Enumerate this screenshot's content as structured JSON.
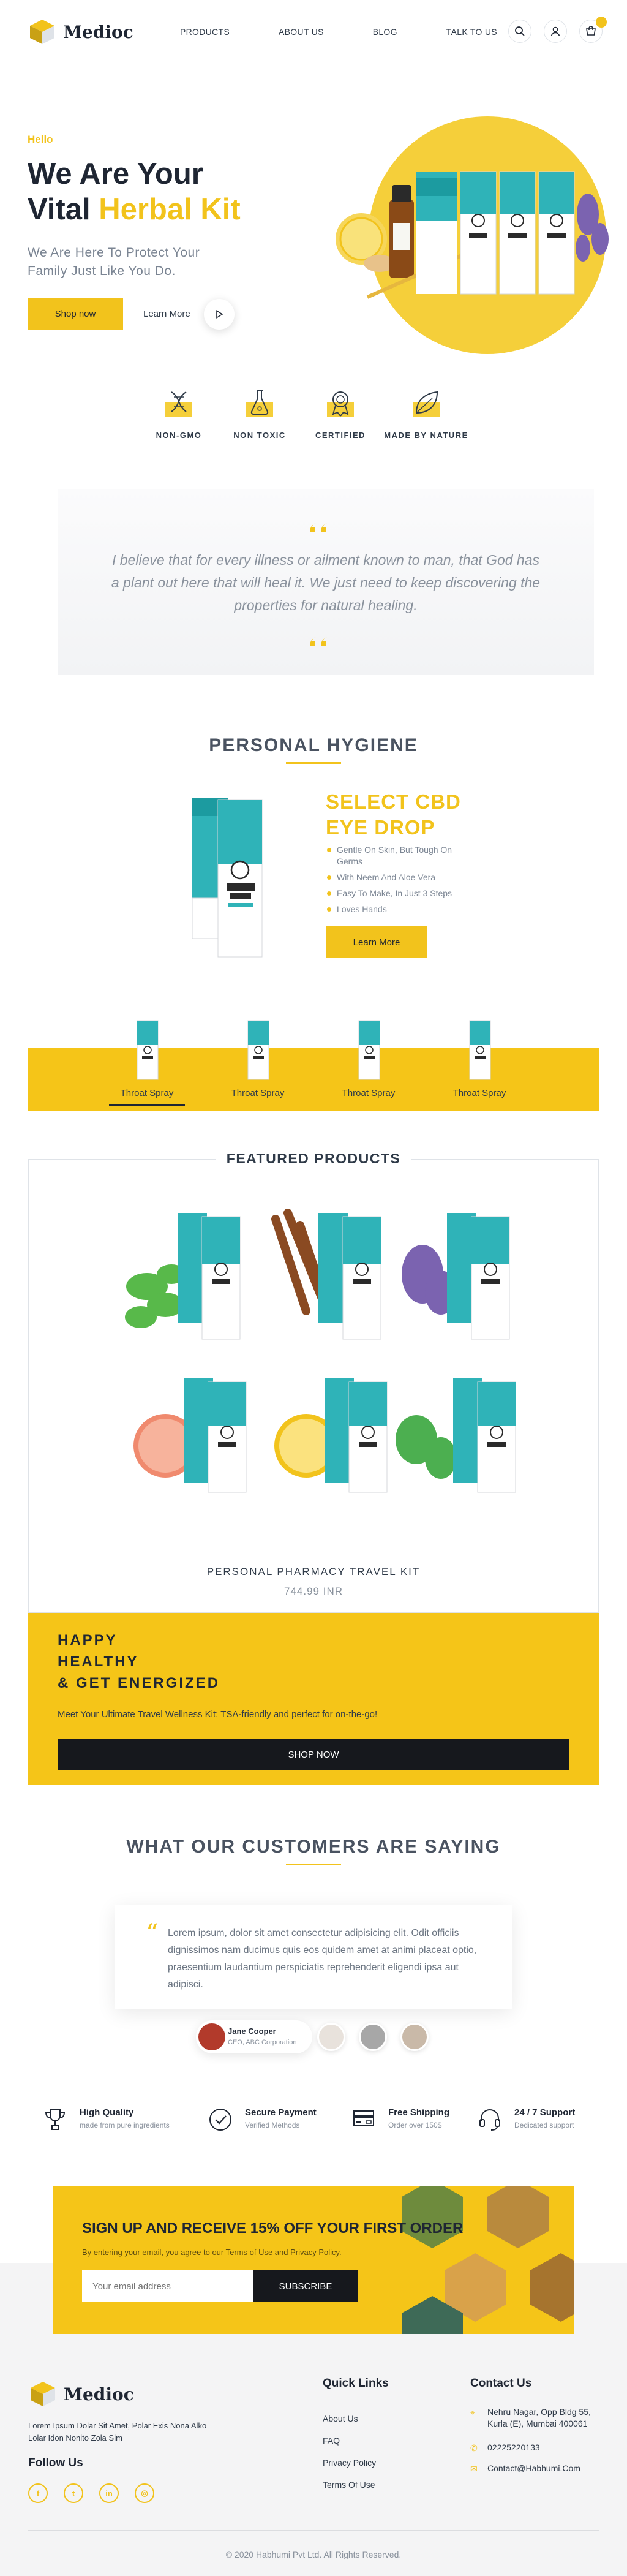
{
  "brand": {
    "name": "Medioc"
  },
  "colors": {
    "accent": "#f2c31c",
    "dark": "#16181d",
    "text": "#2f3a48"
  },
  "nav": {
    "items": [
      {
        "label": "PRODUCTS"
      },
      {
        "label": "ABOUT US"
      },
      {
        "label": "BLOG"
      },
      {
        "label": "TALK TO US"
      }
    ]
  },
  "header_icons": [
    "search-icon",
    "user-icon",
    "cart-icon"
  ],
  "hero": {
    "hello": "Hello",
    "title_line1": "We Are Your",
    "title_line2_a": "Vital",
    "title_line2_b": "Herbal Kit",
    "subtitle_line1": "We Are Here To Protect Your",
    "subtitle_line2": "Family Just Like You Do.",
    "shop_label": "Shop now",
    "learn_label": "Learn More"
  },
  "features": [
    {
      "label": "NON-GMO",
      "icon": "dna-icon"
    },
    {
      "label": "NON TOXIC",
      "icon": "flask-icon"
    },
    {
      "label": "CERTIFIED",
      "icon": "medal-icon"
    },
    {
      "label": "MADE BY NATURE",
      "icon": "leaf-icon"
    }
  ],
  "quote": {
    "text": "I believe that for every illness or ailment known to man, that God has a plant out here that will heal it. We just need to keep discovering the properties for natural healing."
  },
  "personal_hygiene": {
    "title": "PERSONAL HYGIENE",
    "product_title_1": "SELECT CBD",
    "product_title_2": "EYE DROP",
    "bullets": [
      "Gentle On Skin, But Tough On Germs",
      "With Neem And Aloe Vera",
      "Easy To Make, In Just 3 Steps",
      "Loves Hands"
    ],
    "learn_label": "Learn More",
    "tabs": [
      {
        "label": "Throat Spray"
      },
      {
        "label": "Throat Spray"
      },
      {
        "label": "Throat Spray"
      },
      {
        "label": "Throat Spray"
      }
    ],
    "active_tab": 0
  },
  "featured": {
    "title": "FEATURED PRODUCTS",
    "product_name": "PERSONAL PHARMACY TRAVEL KIT",
    "price": "744.99 INR",
    "tiles": [
      "mint-leaves",
      "cinnamon-sticks",
      "lavender",
      "grapefruit",
      "lemon",
      "mint-leaf"
    ]
  },
  "energize": {
    "line1": "HAPPY",
    "line2": "HEALTHY",
    "line3": "& GET ENERGIZED",
    "text": "Meet Your Ultimate Travel Wellness Kit: TSA-friendly and perfect for on-the-go!",
    "button": "SHOP NOW"
  },
  "testimonials": {
    "title": "WHAT OUR CUSTOMERS ARE SAYING",
    "quote": "Lorem ipsum, dolor sit amet consectetur adipisicing elit. Odit officiis dignissimos nam ducimus quis eos quidem amet at animi placeat optio, praesentium laudantium perspiciatis reprehenderit eligendi ipsa aut adipisci.",
    "name": "Jane Cooper",
    "role": "CEO, ABC Corporation"
  },
  "usps": [
    {
      "title": "High Quality",
      "sub": "made from pure ingredients",
      "icon": "trophy-icon"
    },
    {
      "title": "Secure Payment",
      "sub": "Verified Methods",
      "icon": "check-circle-icon"
    },
    {
      "title": "Free Shipping",
      "sub": "Order over 150$",
      "icon": "truck-icon"
    },
    {
      "title": "24 / 7 Support",
      "sub": "Dedicated support",
      "icon": "headset-icon"
    }
  ],
  "signup": {
    "title": "SIGN UP AND RECEIVE 15% OFF YOUR FIRST ORDER",
    "sub": "By entering your email, you agree to our Terms of Use and Privacy Policy.",
    "placeholder": "Your email address",
    "button": "SUBSCRIBE"
  },
  "footer": {
    "brand": "Medioc",
    "desc": "Lorem Ipsum Dolar Sit Amet, Polar Exis Nona Alko Lolar Idon Nonito Zola Sim",
    "follow": "Follow Us",
    "social": [
      "facebook-icon",
      "twitter-icon",
      "linkedin-icon",
      "instagram-icon"
    ],
    "quick_title": "Quick Links",
    "links": [
      "About Us",
      "FAQ",
      "Privacy Policy",
      "Terms Of Use"
    ],
    "contact_title": "Contact Us",
    "address_line1": "Nehru Nagar, Opp Bldg 55,",
    "address_line2": "Kurla (E), Mumbai 400061",
    "phone": "02225220133",
    "email": "Contact@Habhumi.Com",
    "copyright": "© 2020 Habhumi Pvt Ltd. All Rights Reserved."
  }
}
